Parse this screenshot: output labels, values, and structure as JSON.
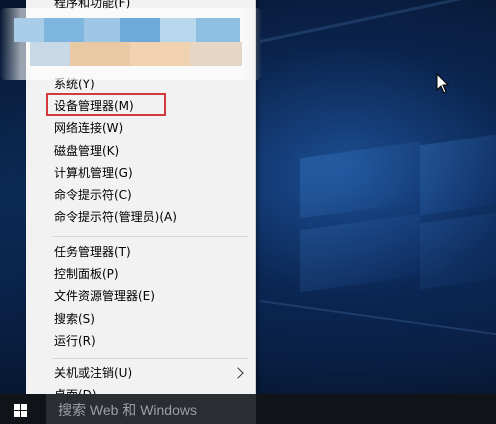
{
  "menu": {
    "top_partial_label": "程序和功能(F)",
    "items_group1": [
      {
        "label": "系统(Y)",
        "name": "menu-item-system"
      },
      {
        "label": "设备管理器(M)",
        "name": "menu-item-device-manager"
      },
      {
        "label": "网络连接(W)",
        "name": "menu-item-network-connections"
      },
      {
        "label": "磁盘管理(K)",
        "name": "menu-item-disk-management"
      },
      {
        "label": "计算机管理(G)",
        "name": "menu-item-computer-management"
      },
      {
        "label": "命令提示符(C)",
        "name": "menu-item-command-prompt"
      },
      {
        "label": "命令提示符(管理员)(A)",
        "name": "menu-item-command-prompt-admin"
      }
    ],
    "items_group2": [
      {
        "label": "任务管理器(T)",
        "name": "menu-item-task-manager"
      },
      {
        "label": "控制面板(P)",
        "name": "menu-item-control-panel"
      },
      {
        "label": "文件资源管理器(E)",
        "name": "menu-item-file-explorer"
      },
      {
        "label": "搜索(S)",
        "name": "menu-item-search"
      },
      {
        "label": "运行(R)",
        "name": "menu-item-run"
      }
    ],
    "items_group3": [
      {
        "label": "关机或注销(U)",
        "name": "menu-item-shutdown-signout",
        "has_submenu": true
      },
      {
        "label": "桌面(D)",
        "name": "menu-item-desktop"
      }
    ],
    "highlighted_item": "设备管理器(M)",
    "highlight_color": "#d23b3b"
  },
  "taskbar": {
    "search_placeholder": "搜索 Web 和 Windows",
    "start_icon": "windows-logo-icon"
  },
  "colors": {
    "menu_bg": "#f2f2f2",
    "taskbar_bg": "#101418",
    "desktop_accent": "#1f5fb0"
  }
}
